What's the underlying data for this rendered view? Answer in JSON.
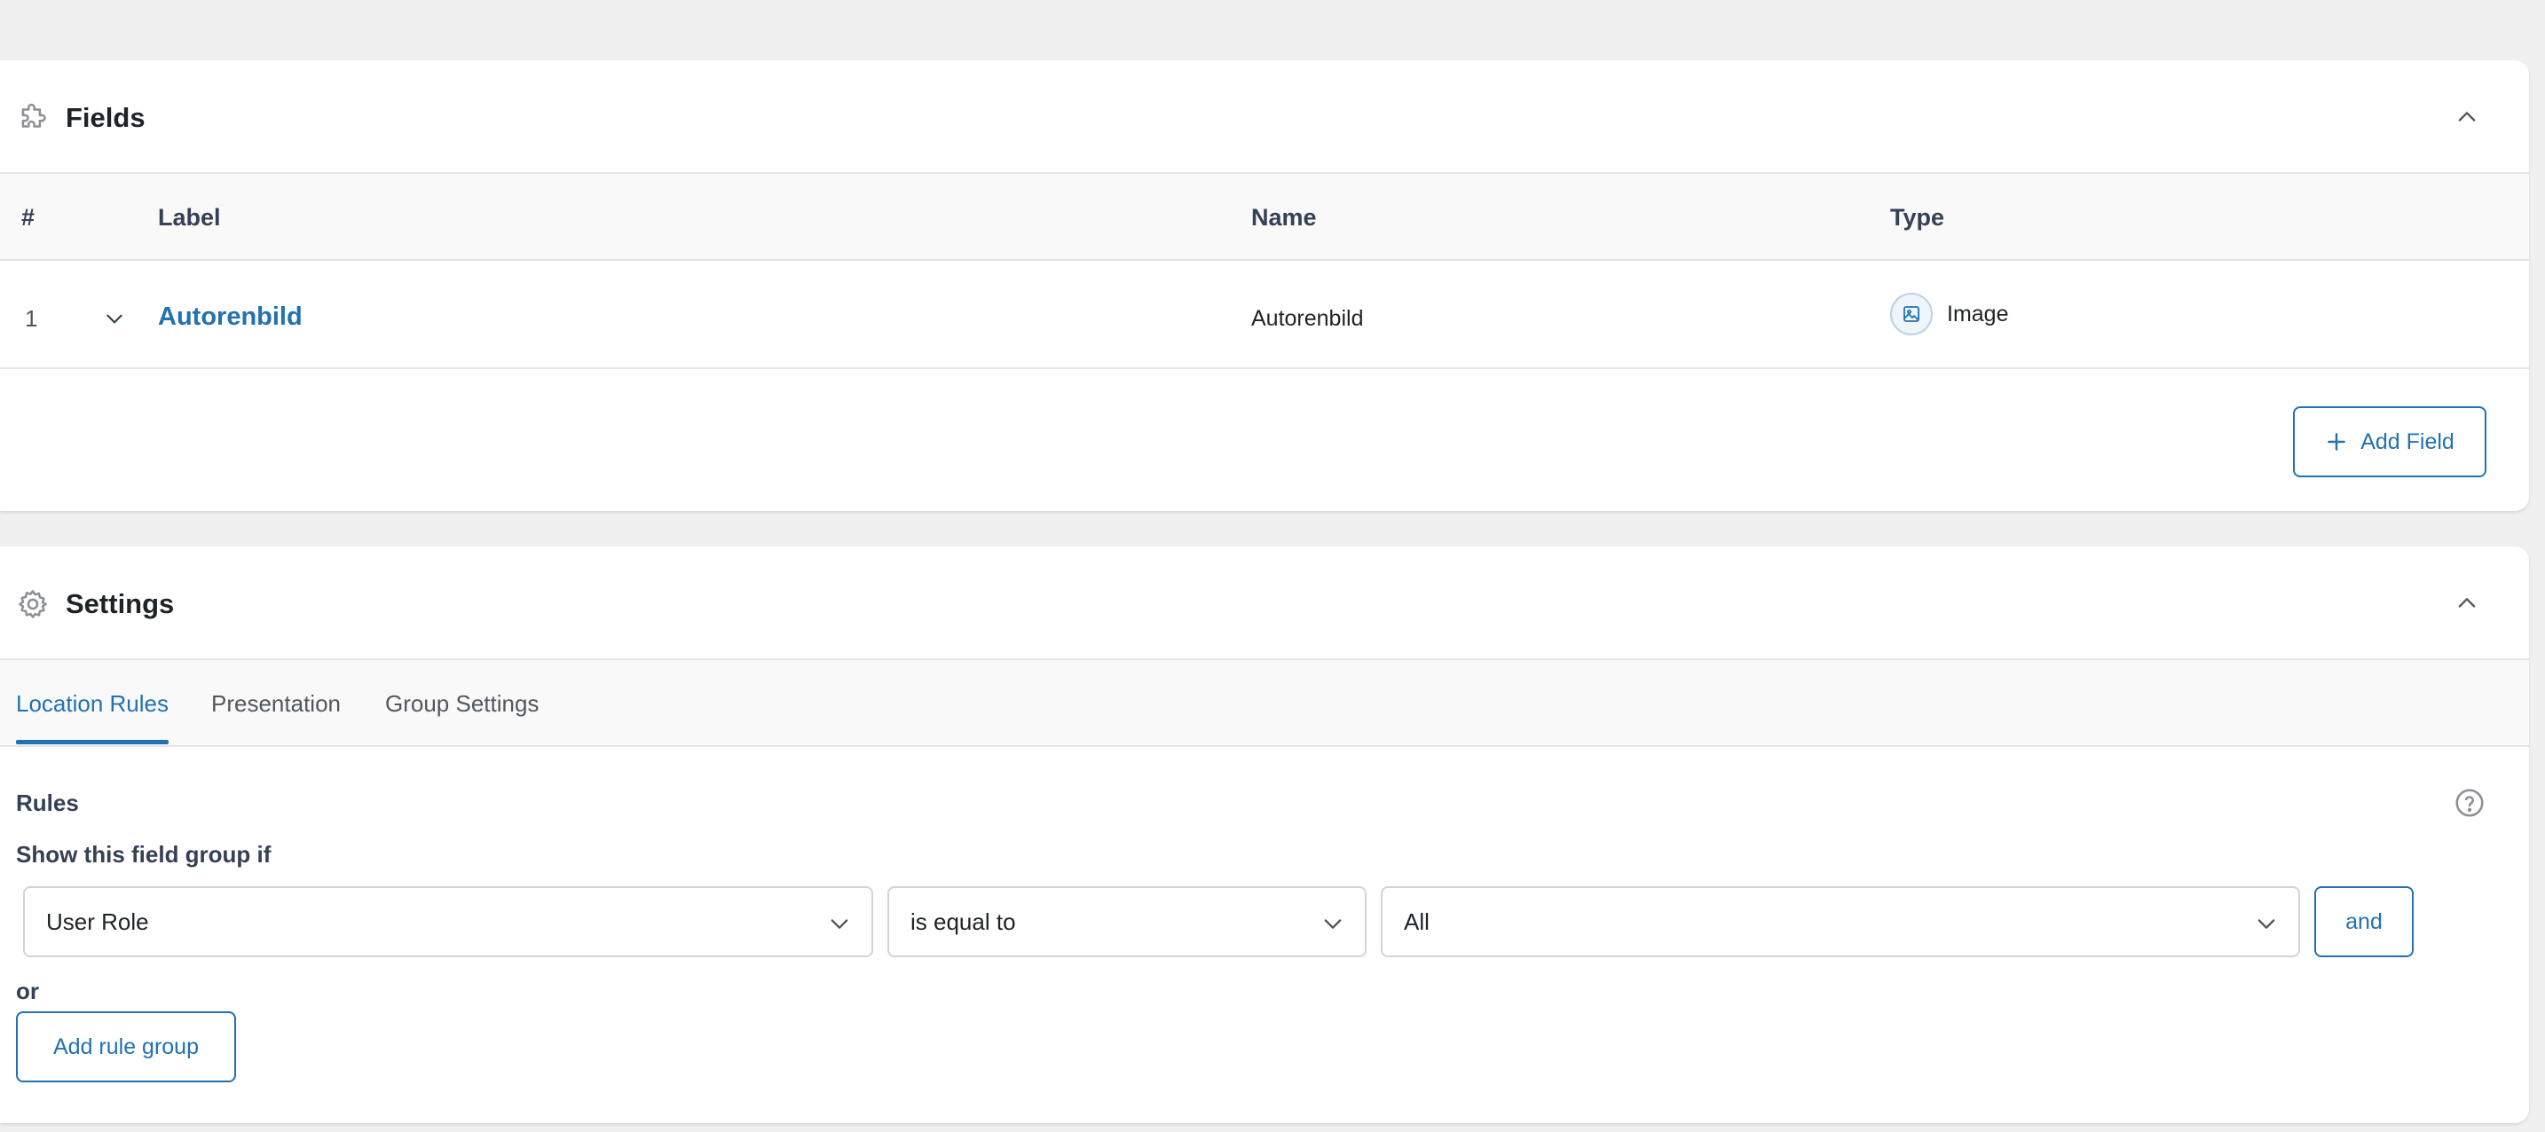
{
  "fields": {
    "title": "Fields",
    "columns": {
      "num": "#",
      "label": "Label",
      "name": "Name",
      "type": "Type"
    },
    "rows": [
      {
        "num": "1",
        "label": "Autorenbild",
        "name": "Autorenbild",
        "type": "Image"
      }
    ],
    "add_field_label": "Add Field"
  },
  "settings": {
    "title": "Settings",
    "tabs": [
      {
        "label": "Location Rules",
        "active": true
      },
      {
        "label": "Presentation",
        "active": false
      },
      {
        "label": "Group Settings",
        "active": false
      }
    ],
    "rules_title": "Rules",
    "show_if": "Show this field group if",
    "rule": {
      "param": "User Role",
      "operator": "is equal to",
      "value": "All"
    },
    "and_label": "and",
    "or_label": "or",
    "add_rule_group_label": "Add rule group"
  },
  "colors": {
    "accent": "#2271b1",
    "background": "#f0f0f1"
  }
}
